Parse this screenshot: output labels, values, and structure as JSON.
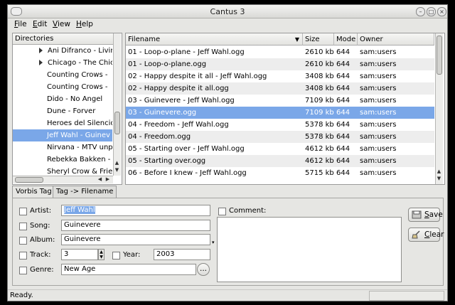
{
  "window": {
    "title": "Cantus 3"
  },
  "menu": [
    {
      "label": "File",
      "accel": "F",
      "rest": "ile"
    },
    {
      "label": "Edit",
      "accel": "E",
      "rest": "dit"
    },
    {
      "label": "View",
      "accel": "V",
      "rest": "iew"
    },
    {
      "label": "Help",
      "accel": "H",
      "rest": "elp"
    }
  ],
  "directories": {
    "header": "Directories",
    "items": [
      {
        "label": "Ani Difranco - Livin",
        "expandable": true
      },
      {
        "label": "Chicago - The Chic",
        "expandable": true
      },
      {
        "label": "Counting Crows -",
        "expandable": false
      },
      {
        "label": "Counting Crows -",
        "expandable": false
      },
      {
        "label": "Dido - No Angel",
        "expandable": false
      },
      {
        "label": "Dune - Forver",
        "expandable": false
      },
      {
        "label": "Heroes del Silencio",
        "expandable": false
      },
      {
        "label": "Jeff Wahl - Guinev",
        "expandable": false,
        "selected": true
      },
      {
        "label": "Nirvana - MTV unp",
        "expandable": false
      },
      {
        "label": "Rebekka Bakken -",
        "expandable": false
      },
      {
        "label": "Sheryl Crow & Frie",
        "expandable": false
      }
    ]
  },
  "files": {
    "columns": [
      "Filename",
      "Size",
      "Mode",
      "Owner"
    ],
    "rows": [
      {
        "filename": "01 - Loop-o-plane - Jeff Wahl.ogg",
        "size": "2610 kb",
        "mode": "644",
        "owner": "sam:users"
      },
      {
        "filename": "01 - Loop-o-plane.ogg",
        "size": "2610 kb",
        "mode": "644",
        "owner": "sam:users"
      },
      {
        "filename": "02 - Happy despite it all - Jeff Wahl.ogg",
        "size": "3408 kb",
        "mode": "644",
        "owner": "sam:users"
      },
      {
        "filename": "02 - Happy despite it all.ogg",
        "size": "3408 kb",
        "mode": "644",
        "owner": "sam:users"
      },
      {
        "filename": "03 - Guinevere - Jeff Wahl.ogg",
        "size": "7109 kb",
        "mode": "644",
        "owner": "sam:users"
      },
      {
        "filename": "03 - Guinevere.ogg",
        "size": "7109 kb",
        "mode": "644",
        "owner": "sam:users",
        "selected": true
      },
      {
        "filename": "04 - Freedom - Jeff Wahl.ogg",
        "size": "5378 kb",
        "mode": "644",
        "owner": "sam:users"
      },
      {
        "filename": "04 - Freedom.ogg",
        "size": "5378 kb",
        "mode": "644",
        "owner": "sam:users"
      },
      {
        "filename": "05 - Starting over - Jeff Wahl.ogg",
        "size": "4612 kb",
        "mode": "644",
        "owner": "sam:users"
      },
      {
        "filename": "05 - Starting over.ogg",
        "size": "4612 kb",
        "mode": "644",
        "owner": "sam:users"
      },
      {
        "filename": "06 - Before I knew - Jeff Wahl.ogg",
        "size": "5715 kb",
        "mode": "644",
        "owner": "sam:users"
      }
    ]
  },
  "tabs": [
    "Vorbis Tag",
    "Tag -> Filename"
  ],
  "tag": {
    "artist_label": "Artist:",
    "artist_value": "Jeff Wahl",
    "song_label": "Song:",
    "song_value": "Guinevere",
    "album_label": "Album:",
    "album_value": "Guinevere",
    "track_label": "Track:",
    "track_value": "3",
    "year_label": "Year:",
    "year_value": "2003",
    "genre_label": "Genre:",
    "genre_value": "New Age",
    "genre_browse": "...",
    "comment_label": "Comment:",
    "comment_value": ""
  },
  "buttons": {
    "save_accel": "S",
    "save_rest": "ave",
    "clear_accel": "C",
    "clear_rest": "lear"
  },
  "status": {
    "text": "Ready."
  },
  "colors": {
    "selection": "#7aa7e8",
    "window_bg": "#e6e6e3"
  }
}
